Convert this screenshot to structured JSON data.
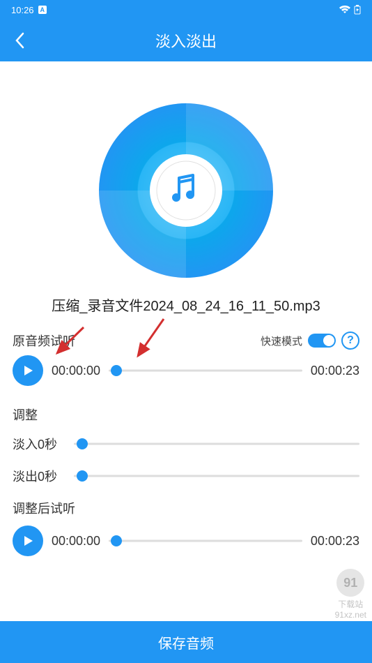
{
  "status": {
    "time": "10:26",
    "badge": "A"
  },
  "header": {
    "title": "淡入淡出"
  },
  "file": {
    "name": "压缩_录音文件2024_08_24_16_11_50.mp3"
  },
  "original": {
    "sectionLabel": "原音频试听",
    "fastModeLabel": "快速模式",
    "currentTime": "00:00:00",
    "totalTime": "00:00:23"
  },
  "adjust": {
    "title": "调整",
    "fadeInLabel": "淡入0秒",
    "fadeOutLabel": "淡出0秒"
  },
  "adjusted": {
    "sectionLabel": "调整后试听",
    "currentTime": "00:00:00",
    "totalTime": "00:00:23"
  },
  "bottom": {
    "saveLabel": "保存音频"
  },
  "watermark": {
    "logo": "91",
    "text": "下载站",
    "url": "91xz.net"
  }
}
